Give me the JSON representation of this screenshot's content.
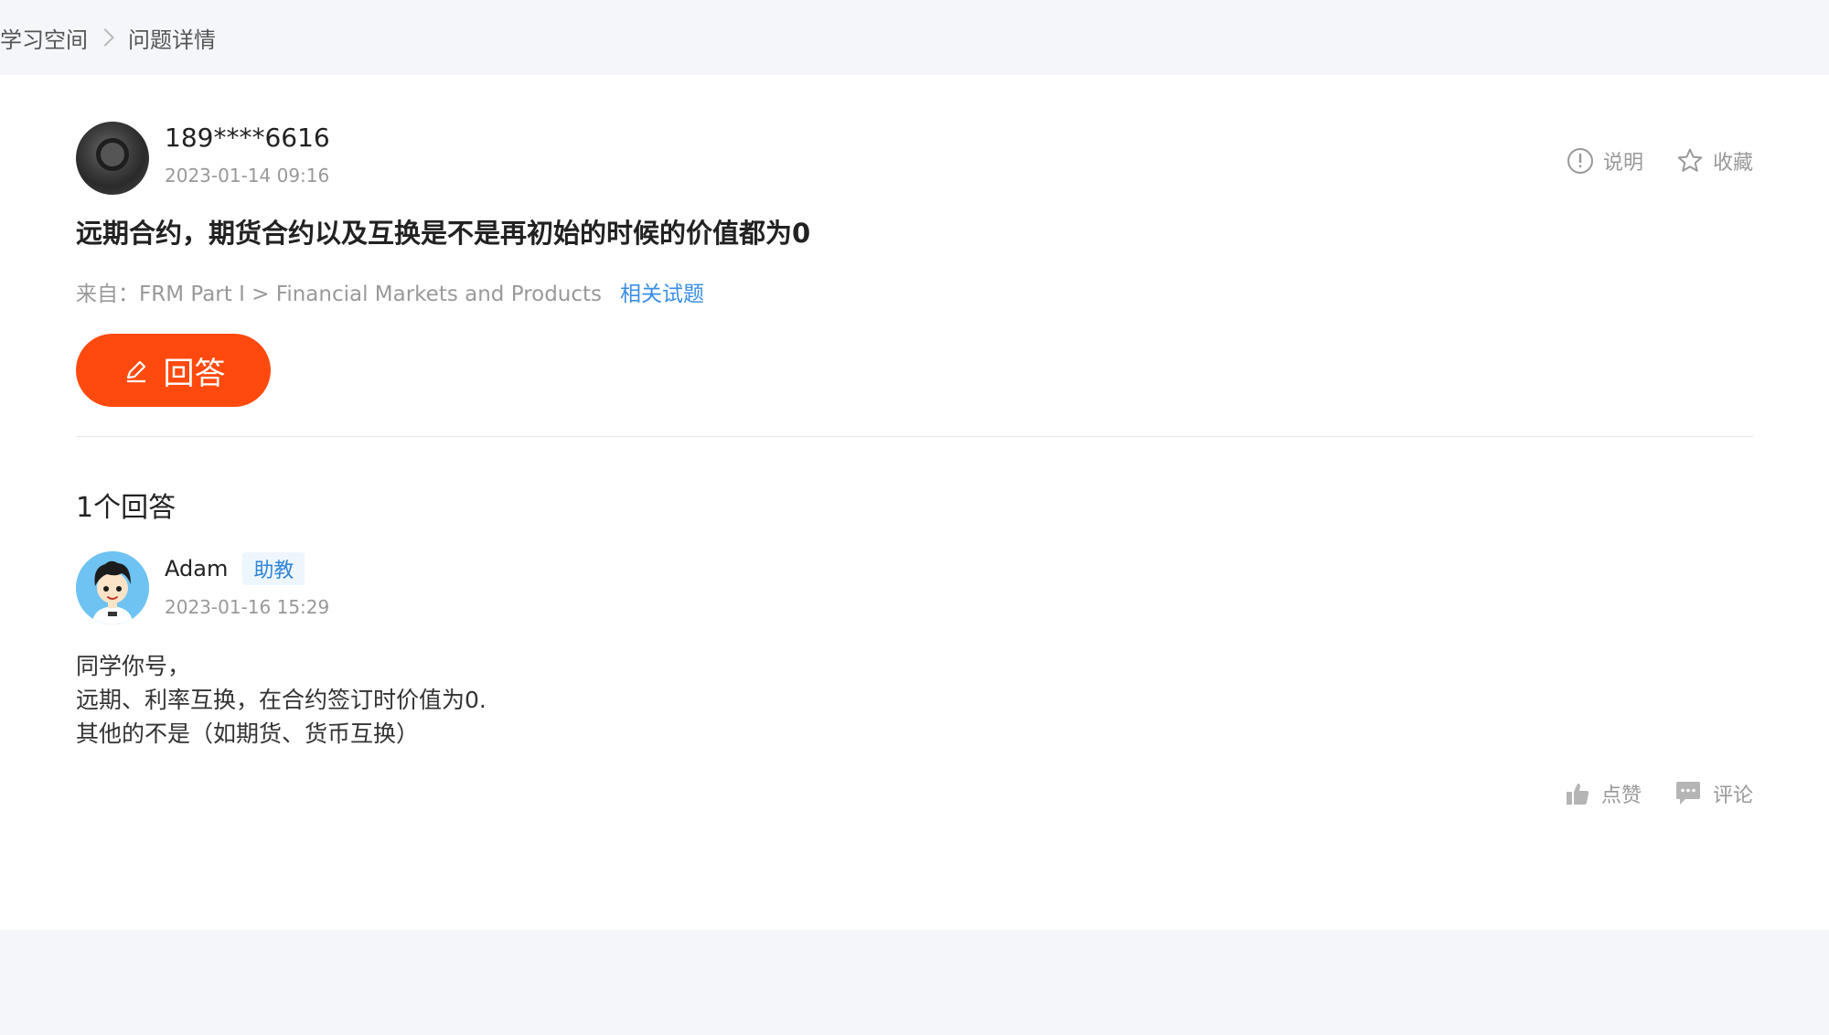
{
  "breadcrumb": {
    "root": "学习空间",
    "current": "问题详情"
  },
  "question": {
    "username": "189****6616",
    "time": "2023-01-14 09:16",
    "title": "远期合约，期货合约以及互换是不是再初始的时候的价值都为0",
    "source": "来自：FRM Part I > Financial Markets and Products",
    "related_link": "相关试题",
    "explain_label": "说明",
    "favorite_label": "收藏",
    "answer_button": "回答"
  },
  "answers": {
    "count_label": "1个回答",
    "items": [
      {
        "username": "Adam",
        "role_badge": "助教",
        "time": "2023-01-16 15:29",
        "lines": [
          "同学你号，",
          "远期、利率互换，在合约签订时价值为0.",
          "其他的不是（如期货、货币互换）"
        ],
        "like_label": "点赞",
        "comment_label": "评论"
      }
    ]
  },
  "colors": {
    "accent": "#ff4a0f",
    "link": "#3a8ee6",
    "page_bg": "#f4f6fa"
  }
}
